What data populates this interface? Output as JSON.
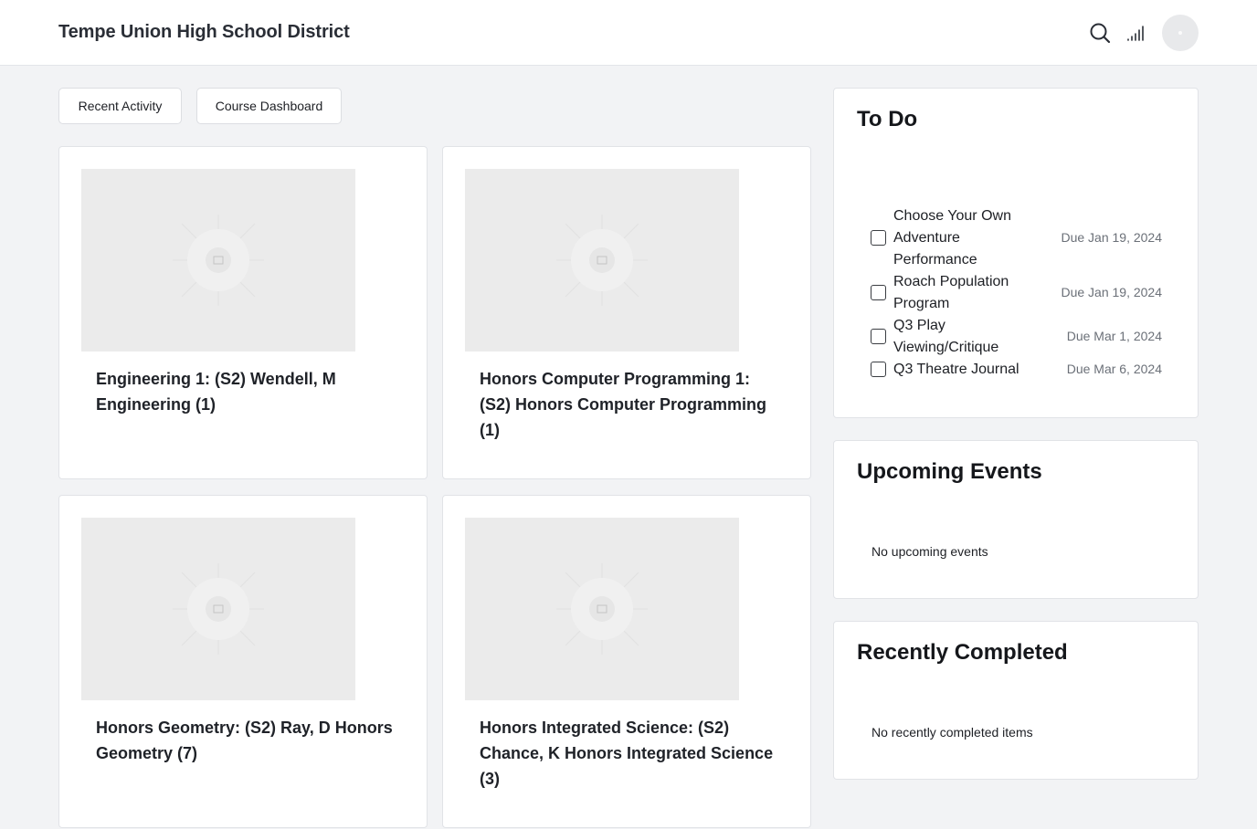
{
  "header": {
    "title": "Tempe Union High School District",
    "icons": [
      "search-icon",
      "signal-icon",
      "avatar"
    ]
  },
  "tabs": [
    {
      "label": "Recent Activity"
    },
    {
      "label": "Course Dashboard"
    }
  ],
  "courses": [
    {
      "title": "Engineering 1: (S2) Wendell, M Engineering (1)"
    },
    {
      "title": "Honors Computer Programming 1: (S2) Honors Computer Programming (1)"
    },
    {
      "title": "Honors Geometry: (S2) Ray, D Honors Geometry (7)"
    },
    {
      "title": "Honors Integrated Science: (S2) Chance, K Honors Integrated Science (3)"
    }
  ],
  "todo": {
    "heading": "To Do",
    "items": [
      {
        "label": "Choose Your Own Adventure Performance",
        "due": "Due Jan 19, 2024"
      },
      {
        "label": "Roach Population Program",
        "due": "Due Jan 19, 2024"
      },
      {
        "label": "Q3 Play Viewing/Critique",
        "due": "Due Mar 1, 2024"
      },
      {
        "label": "Q3 Theatre Journal",
        "due": "Due Mar 6, 2024"
      }
    ]
  },
  "events": {
    "heading": "Upcoming Events",
    "empty": "No upcoming events"
  },
  "completed": {
    "heading": "Recently Completed",
    "empty": "No recently completed items"
  },
  "colors": {
    "background": "#f2f3f5",
    "card": "#ffffff",
    "thumbnail": "#ebebeb",
    "due_text": "#6b7078"
  }
}
